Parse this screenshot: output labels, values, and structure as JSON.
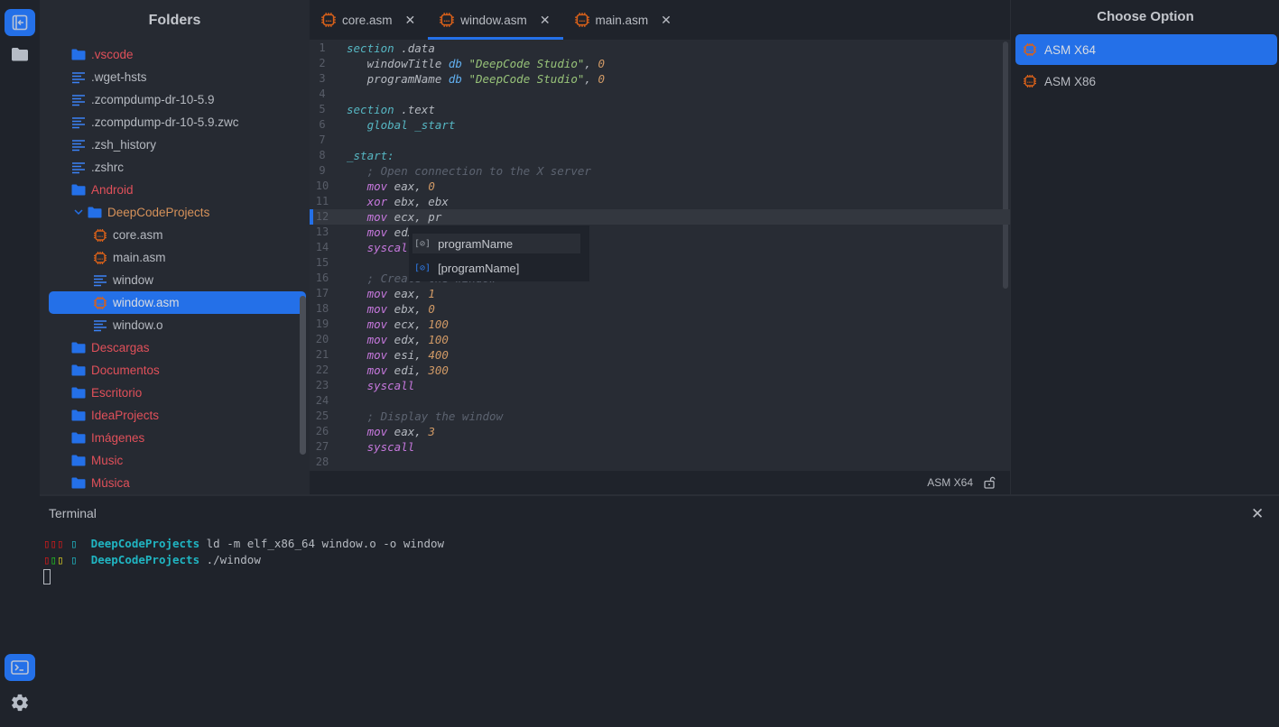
{
  "activity_bar": {
    "top_items": [
      {
        "name": "toggle-explorer",
        "icon": "panel-left-arrow-icon",
        "active": true
      },
      {
        "name": "folders",
        "icon": "folder-icon",
        "active": false
      }
    ],
    "bottom_items": [
      {
        "name": "terminal",
        "icon": "terminal-icon",
        "active": true
      },
      {
        "name": "settings",
        "icon": "gear-icon",
        "active": false
      }
    ]
  },
  "sidebar": {
    "title": "Folders",
    "items": [
      {
        "label": ".vscode",
        "type": "folder",
        "depth": 0
      },
      {
        "label": ".wget-hsts",
        "type": "file",
        "depth": 0
      },
      {
        "label": ".zcompdump-dr-10-5.9",
        "type": "file",
        "depth": 0
      },
      {
        "label": ".zcompdump-dr-10-5.9.zwc",
        "type": "file",
        "depth": 0
      },
      {
        "label": ".zsh_history",
        "type": "file",
        "depth": 0
      },
      {
        "label": ".zshrc",
        "type": "file",
        "depth": 0
      },
      {
        "label": "Android",
        "type": "folder",
        "depth": 0
      },
      {
        "label": "DeepCodeProjects",
        "type": "folder-open",
        "depth": 0
      },
      {
        "label": "core.asm",
        "type": "asm",
        "depth": 1
      },
      {
        "label": "main.asm",
        "type": "asm",
        "depth": 1
      },
      {
        "label": "window",
        "type": "file",
        "depth": 1
      },
      {
        "label": "window.asm",
        "type": "asm",
        "depth": 1,
        "selected": true
      },
      {
        "label": "window.o",
        "type": "file",
        "depth": 1
      },
      {
        "label": "Descargas",
        "type": "folder",
        "depth": 0
      },
      {
        "label": "Documentos",
        "type": "folder",
        "depth": 0
      },
      {
        "label": "Escritorio",
        "type": "folder",
        "depth": 0
      },
      {
        "label": "IdeaProjects",
        "type": "folder",
        "depth": 0
      },
      {
        "label": "Imágenes",
        "type": "folder",
        "depth": 0
      },
      {
        "label": "Music",
        "type": "folder",
        "depth": 0
      },
      {
        "label": "Música",
        "type": "folder",
        "depth": 0
      }
    ]
  },
  "editor": {
    "tabs": [
      {
        "label": "core.asm",
        "active": false
      },
      {
        "label": "window.asm",
        "active": true
      },
      {
        "label": "main.asm",
        "active": false
      }
    ],
    "close_glyph": "✕",
    "current_line": 12,
    "lines": [
      [
        {
          "t": "section",
          "c": "kw-sec"
        },
        {
          "t": " .data",
          "c": "ident"
        }
      ],
      [
        {
          "t": "   windowTitle ",
          "c": "ident"
        },
        {
          "t": "db",
          "c": "kw-db"
        },
        {
          "t": " ",
          "c": "ident"
        },
        {
          "t": "\"DeepCode Studio\"",
          "c": "str"
        },
        {
          "t": ", ",
          "c": "ident"
        },
        {
          "t": "0",
          "c": "num"
        }
      ],
      [
        {
          "t": "   programName ",
          "c": "ident"
        },
        {
          "t": "db",
          "c": "kw-db"
        },
        {
          "t": " ",
          "c": "ident"
        },
        {
          "t": "\"DeepCode Studio\"",
          "c": "str"
        },
        {
          "t": ", ",
          "c": "ident"
        },
        {
          "t": "0",
          "c": "num"
        }
      ],
      [],
      [
        {
          "t": "section",
          "c": "kw-sec"
        },
        {
          "t": " .text",
          "c": "ident"
        }
      ],
      [
        {
          "t": "   global _start",
          "c": "kw-sec"
        }
      ],
      [],
      [
        {
          "t": "_start:",
          "c": "kw-sec"
        }
      ],
      [
        {
          "t": "   ; Open connection to the X server",
          "c": "cmt"
        }
      ],
      [
        {
          "t": "   ",
          "c": "ident"
        },
        {
          "t": "mov",
          "c": "kw-op"
        },
        {
          "t": " eax, ",
          "c": "ident"
        },
        {
          "t": "0",
          "c": "num"
        }
      ],
      [
        {
          "t": "   ",
          "c": "ident"
        },
        {
          "t": "xor",
          "c": "kw-op"
        },
        {
          "t": " ebx, ebx",
          "c": "ident"
        }
      ],
      [
        {
          "t": "   ",
          "c": "ident"
        },
        {
          "t": "mov",
          "c": "kw-op"
        },
        {
          "t": " ecx, pr",
          "c": "ident"
        }
      ],
      [
        {
          "t": "   ",
          "c": "ident"
        },
        {
          "t": "mov",
          "c": "kw-op"
        },
        {
          "t": " edx, programName",
          "c": "ident"
        }
      ],
      [
        {
          "t": "   syscall",
          "c": "kw-op"
        }
      ],
      [],
      [
        {
          "t": "   ; Create the window",
          "c": "cmt"
        }
      ],
      [
        {
          "t": "   ",
          "c": "ident"
        },
        {
          "t": "mov",
          "c": "kw-op"
        },
        {
          "t": " eax, ",
          "c": "ident"
        },
        {
          "t": "1",
          "c": "num"
        }
      ],
      [
        {
          "t": "   ",
          "c": "ident"
        },
        {
          "t": "mov",
          "c": "kw-op"
        },
        {
          "t": " ebx, ",
          "c": "ident"
        },
        {
          "t": "0",
          "c": "num"
        }
      ],
      [
        {
          "t": "   ",
          "c": "ident"
        },
        {
          "t": "mov",
          "c": "kw-op"
        },
        {
          "t": " ecx, ",
          "c": "ident"
        },
        {
          "t": "100",
          "c": "num"
        }
      ],
      [
        {
          "t": "   ",
          "c": "ident"
        },
        {
          "t": "mov",
          "c": "kw-op"
        },
        {
          "t": " edx, ",
          "c": "ident"
        },
        {
          "t": "100",
          "c": "num"
        }
      ],
      [
        {
          "t": "   ",
          "c": "ident"
        },
        {
          "t": "mov",
          "c": "kw-op"
        },
        {
          "t": " esi, ",
          "c": "ident"
        },
        {
          "t": "400",
          "c": "num"
        }
      ],
      [
        {
          "t": "   ",
          "c": "ident"
        },
        {
          "t": "mov",
          "c": "kw-op"
        },
        {
          "t": " edi, ",
          "c": "ident"
        },
        {
          "t": "300",
          "c": "num"
        }
      ],
      [
        {
          "t": "   syscall",
          "c": "kw-op"
        }
      ],
      [],
      [
        {
          "t": "   ; Display the window",
          "c": "cmt"
        }
      ],
      [
        {
          "t": "   ",
          "c": "ident"
        },
        {
          "t": "mov",
          "c": "kw-op"
        },
        {
          "t": " eax, ",
          "c": "ident"
        },
        {
          "t": "3",
          "c": "num"
        }
      ],
      [
        {
          "t": "   syscall",
          "c": "kw-op"
        }
      ],
      []
    ],
    "autocomplete": {
      "items": [
        {
          "icon": "[⊘]",
          "label": "programName",
          "active": true
        },
        {
          "icon": "[⊘]",
          "label": "[programName]",
          "active": false
        }
      ]
    },
    "status": {
      "language": "ASM X64",
      "lock_icon": "unlock-icon"
    }
  },
  "right_panel": {
    "title": "Choose Option",
    "options": [
      {
        "label": "ASM X64",
        "active": true
      },
      {
        "label": "ASM X86",
        "active": false
      }
    ]
  },
  "terminal": {
    "title": "Terminal",
    "close_glyph": "✕",
    "lines": [
      {
        "prompt": [
          {
            "t": "▯▯▯",
            "c": "t-red"
          },
          {
            "t": " ▯ ",
            "c": "t-cyan"
          }
        ],
        "dir": "DeepCodeProjects",
        "cmd": " ld -m elf_x86_64 window.o -o window"
      },
      {
        "prompt": [
          {
            "t": "▯",
            "c": "t-red"
          },
          {
            "t": "▯",
            "c": "t-green"
          },
          {
            "t": "▯",
            "c": "t-yellow"
          },
          {
            "t": " ▯ ",
            "c": "t-cyan"
          }
        ],
        "dir": "DeepCodeProjects",
        "cmd": " ./window"
      }
    ]
  },
  "colors": {
    "accent": "#2470e8",
    "folder_label": "#e0505a",
    "open_folder_label": "#d7925a",
    "asm_icon": "#d9611a",
    "file_icon": "#3b82f6"
  }
}
